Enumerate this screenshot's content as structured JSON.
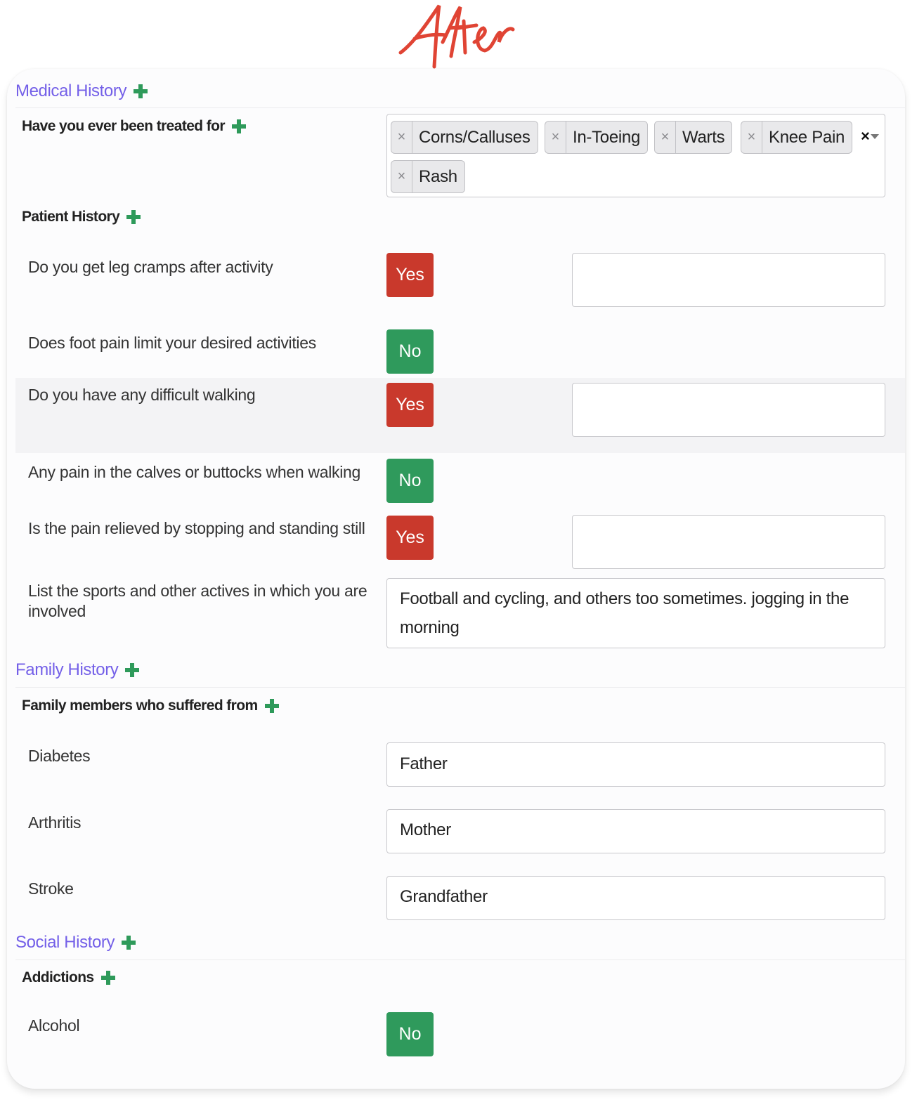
{
  "banner": {
    "label": "After",
    "color": "#e04434"
  },
  "colors": {
    "section_title": "#7460e8",
    "plus": "#2e9a5a",
    "yes": "#c9392c",
    "no": "#2f9a5c"
  },
  "medical_history": {
    "title": "Medical History",
    "treated_for": {
      "label": "Have you ever been treated for",
      "selected": [
        "Corns/Calluses",
        "In-Toeing",
        "Warts",
        "Knee Pain",
        "Rash"
      ],
      "remove_glyph": "×",
      "clear_glyph": "×"
    },
    "patient_history": {
      "label": "Patient History",
      "questions": [
        {
          "label": "Do you get leg cramps after activity",
          "answer": "Yes",
          "notes": ""
        },
        {
          "label": "Does foot pain limit your desired activities",
          "answer": "No"
        },
        {
          "label": "Do you have any difficult walking",
          "answer": "Yes",
          "notes": ""
        },
        {
          "label": "Any pain in the calves or buttocks when walking",
          "answer": "No"
        },
        {
          "label": "Is the pain relieved by stopping and standing still",
          "answer": "Yes",
          "notes": ""
        }
      ],
      "sports": {
        "label": "List the sports and other actives in which you are involved",
        "value": "Football and cycling, and others too sometimes. jogging in the morning"
      }
    }
  },
  "family_history": {
    "title": "Family History",
    "group_label": "Family members who suffered from",
    "conditions": [
      {
        "label": "Diabetes",
        "value": "Father"
      },
      {
        "label": "Arthritis",
        "value": "Mother"
      },
      {
        "label": "Stroke",
        "value": "Grandfather"
      }
    ]
  },
  "social_history": {
    "title": "Social History",
    "group_label": "Addictions",
    "items": [
      {
        "label": "Alcohol",
        "answer": "No"
      }
    ]
  }
}
